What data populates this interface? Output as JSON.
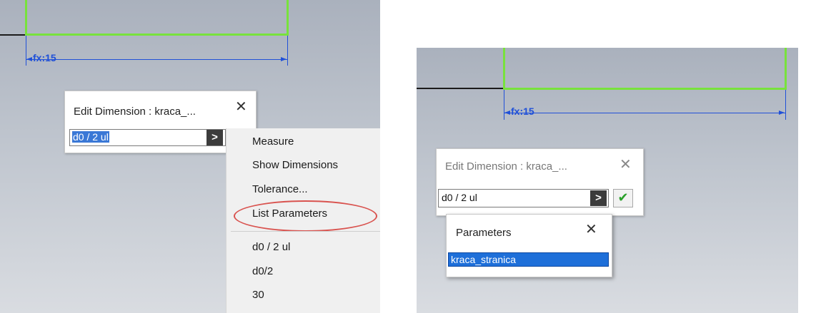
{
  "left_example": {
    "dimension_label": "fx:15",
    "edit_dialog": {
      "title": "Edit Dimension : kraca_...",
      "close_glyph": "✕",
      "input_value": "d0 / 2 ul",
      "expand_glyph": ">"
    },
    "context_menu": {
      "items": [
        "Measure",
        "Show Dimensions",
        "Tolerance...",
        "List Parameters"
      ],
      "recent_values": [
        "d0 / 2 ul",
        "d0/2",
        "30"
      ],
      "highlight_color": "#d9534f"
    }
  },
  "right_example": {
    "dimension_label": "fx:15",
    "edit_dialog": {
      "title": "Edit Dimension : kraca_...",
      "close_glyph": "✕",
      "input_value": "d0 / 2 ul",
      "expand_glyph": ">",
      "accept_glyph": "✔"
    },
    "parameters_popup": {
      "title": "Parameters",
      "close_glyph": "✕",
      "items": [
        "kraca_stranica"
      ]
    }
  },
  "colors": {
    "sketch_geometry": "#78e23c",
    "dimension": "#2050d8",
    "selection": "#1e6fd9"
  },
  "icons": [
    "close-icon",
    "chevron-right-icon",
    "checkmark-icon"
  ]
}
